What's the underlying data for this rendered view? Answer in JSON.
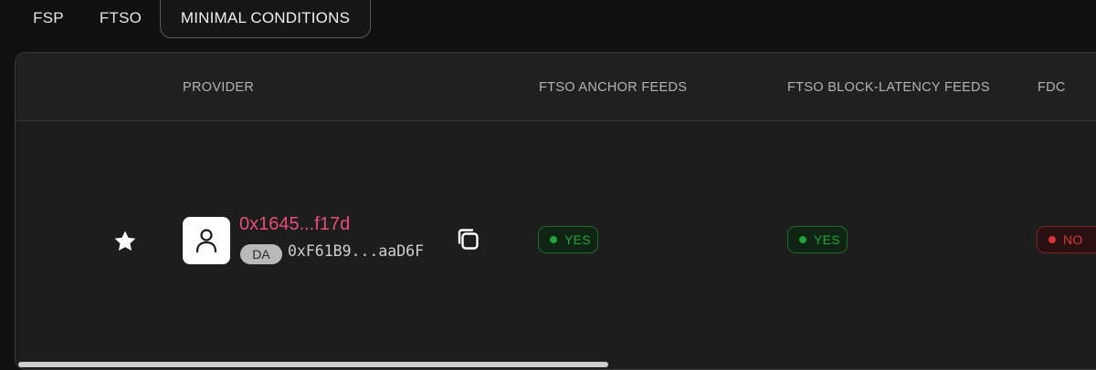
{
  "tabs": [
    {
      "label": "FSP"
    },
    {
      "label": "FTSO"
    },
    {
      "label": "MINIMAL CONDITIONS",
      "active": true
    }
  ],
  "table": {
    "columns": [
      {
        "label": "PROVIDER"
      },
      {
        "label": "FTSO ANCHOR FEEDS"
      },
      {
        "label": "FTSO BLOCK-LATENCY FEEDS"
      },
      {
        "label": "FDC"
      }
    ],
    "rows": [
      {
        "favorite_icon": "star-icon",
        "avatar_icon": "user-icon",
        "provider_name": "0x1645...f17d",
        "badge": "DA",
        "delegation_address": "0xF61B9...aaD6F",
        "copy_icon": "copy-icon",
        "ftso_anchor_feeds": "YES",
        "ftso_block_latency_feeds": "YES",
        "fdc": "NO"
      }
    ]
  },
  "colors": {
    "background": "#101010",
    "card": "#1d1d1d",
    "provider_name": "#e84d7a",
    "status_yes": "#23a33b",
    "status_no": "#d6383a"
  }
}
